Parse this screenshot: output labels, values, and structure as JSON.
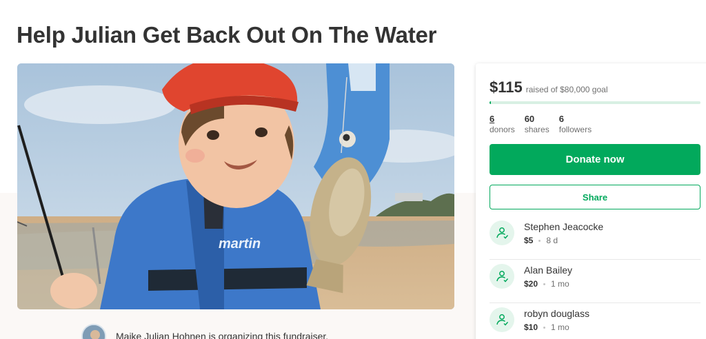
{
  "campaign": {
    "title": "Help Julian Get Back Out On The Water",
    "organizer_text": "Maike Julian Hohnen is organizing this fundraiser."
  },
  "hero": {
    "jacket_brand": "martin"
  },
  "stats": {
    "raised": "$115",
    "goal_text": "raised of $80,000 goal",
    "progress_fraction": 0.0014,
    "donors": {
      "count": "6",
      "label": "donors"
    },
    "shares": {
      "count": "60",
      "label": "shares"
    },
    "followers": {
      "count": "6",
      "label": "followers"
    }
  },
  "actions": {
    "donate_label": "Donate now",
    "share_label": "Share"
  },
  "donations": [
    {
      "name": "Stephen Jeacocke",
      "amount": "$5",
      "time": "8 d"
    },
    {
      "name": "Alan Bailey",
      "amount": "$20",
      "time": "1 mo"
    },
    {
      "name": "robyn douglass",
      "amount": "$10",
      "time": "1 mo"
    }
  ],
  "colors": {
    "accent": "#02a95c",
    "accent_light": "#e4f5ec",
    "text": "#333333",
    "muted": "#6f6f6f",
    "band": "#fbf8f6"
  },
  "icons": {
    "donor": "hand-heart-icon"
  }
}
